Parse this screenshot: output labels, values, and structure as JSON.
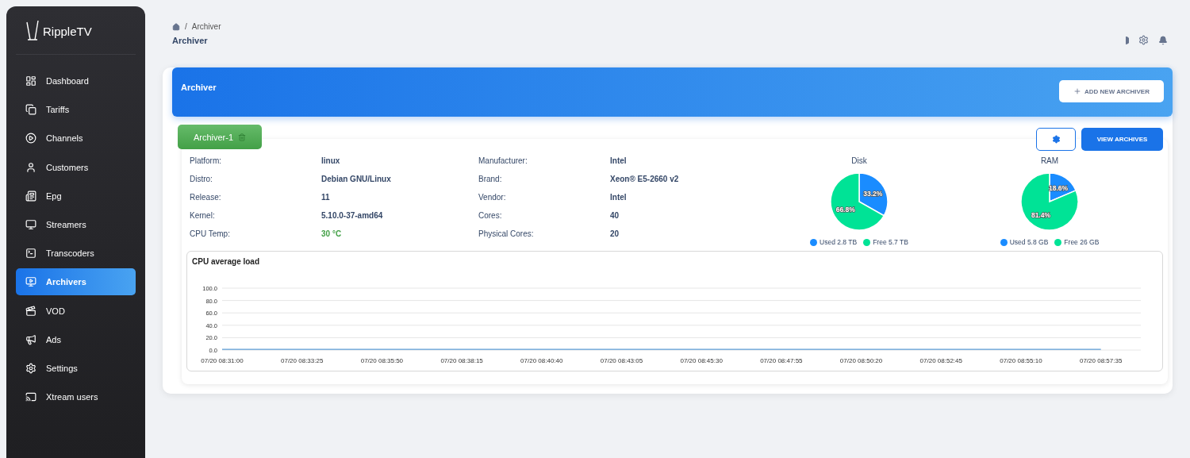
{
  "sidebar": {
    "logo": "RippleTV",
    "items": [
      {
        "label": "Dashboard",
        "selected": false
      },
      {
        "label": "Tariffs",
        "selected": false
      },
      {
        "label": "Channels",
        "selected": false
      },
      {
        "label": "Customers",
        "selected": false
      },
      {
        "label": "Epg",
        "selected": false
      },
      {
        "label": "Streamers",
        "selected": false
      },
      {
        "label": "Transcoders",
        "selected": false
      },
      {
        "label": "Archivers",
        "selected": true
      },
      {
        "label": "VOD",
        "selected": false
      },
      {
        "label": "Ads",
        "selected": false
      },
      {
        "label": "Settings",
        "selected": false
      },
      {
        "label": "Xtream users",
        "selected": false
      }
    ]
  },
  "breadcrumb": {
    "separator": "/",
    "current": "Archiver"
  },
  "page_title": "Archiver",
  "panel": {
    "title": "Archiver",
    "add_button": "ADD NEW ARCHIVER"
  },
  "archiver": {
    "tab": "Archiver-1",
    "view_button": "VIEW ARCHIVES",
    "specs_left": [
      {
        "label": "Platform:",
        "value": "linux",
        "kind": "text"
      },
      {
        "label": "Distro:",
        "value": "Debian GNU/Linux",
        "kind": "text"
      },
      {
        "label": "Release:",
        "value": "11",
        "kind": "text"
      },
      {
        "label": "Kernel:",
        "value": "5.10.0-37-amd64",
        "kind": "text"
      },
      {
        "label": "CPU Temp:",
        "value": "30 °C",
        "kind": "temperature"
      }
    ],
    "specs_right": [
      {
        "label": "Manufacturer:",
        "value": "Intel",
        "kind": "text"
      },
      {
        "label": "Brand:",
        "value": "Xeon® E5-2660 v2",
        "kind": "text"
      },
      {
        "label": "Vendor:",
        "value": "Intel",
        "kind": "text"
      },
      {
        "label": "Cores:",
        "value": "40",
        "kind": "text"
      },
      {
        "label": "Physical Cores:",
        "value": "20",
        "kind": "text"
      }
    ],
    "pies": [
      {
        "chart_data": {
          "type": "pie",
          "legend": true,
          "title": "Disk",
          "categories": [
            "Used 2.8 TB",
            "Free 5.7 TB"
          ],
          "values": [
            33.2,
            66.8
          ],
          "value_labels": [
            "33.2%",
            "66.8%"
          ]
        }
      },
      {
        "chart_data": {
          "type": "pie",
          "legend": true,
          "title": "RAM",
          "categories": [
            "Used 5.8 GB",
            "Free 26 GB"
          ],
          "values": [
            18.6,
            81.4
          ],
          "value_labels": [
            "18.6%",
            "81.4%"
          ]
        }
      }
    ],
    "cpu": {
      "chart_data": {
        "type": "line",
        "grid": true,
        "title": "CPU average load",
        "x": [
          "07/20 08:31:00",
          "07/20 08:33:25",
          "07/20 08:35:50",
          "07/20 08:38:15",
          "07/20 08:40:40",
          "07/20 08:43:05",
          "07/20 08:45:30",
          "07/20 08:47:55",
          "07/20 08:50:20",
          "07/20 08:52:45",
          "07/20 08:55:10",
          "07/20 08:57:35"
        ],
        "series": [
          {
            "color": "#5b9bd5",
            "values": [
              1,
              1,
              1,
              1,
              1,
              1,
              1,
              1,
              1,
              1,
              1,
              1
            ]
          }
        ],
        "ylim": [
          0,
          100
        ],
        "yticks": [
          {
            "value": 0,
            "label": "0.0"
          },
          {
            "value": 20,
            "label": "20.0"
          },
          {
            "value": 40,
            "label": "40.0"
          },
          {
            "value": 60,
            "label": "60.0"
          },
          {
            "value": 80,
            "label": "80.0"
          },
          {
            "value": 100,
            "label": "100.0"
          }
        ]
      }
    }
  }
}
